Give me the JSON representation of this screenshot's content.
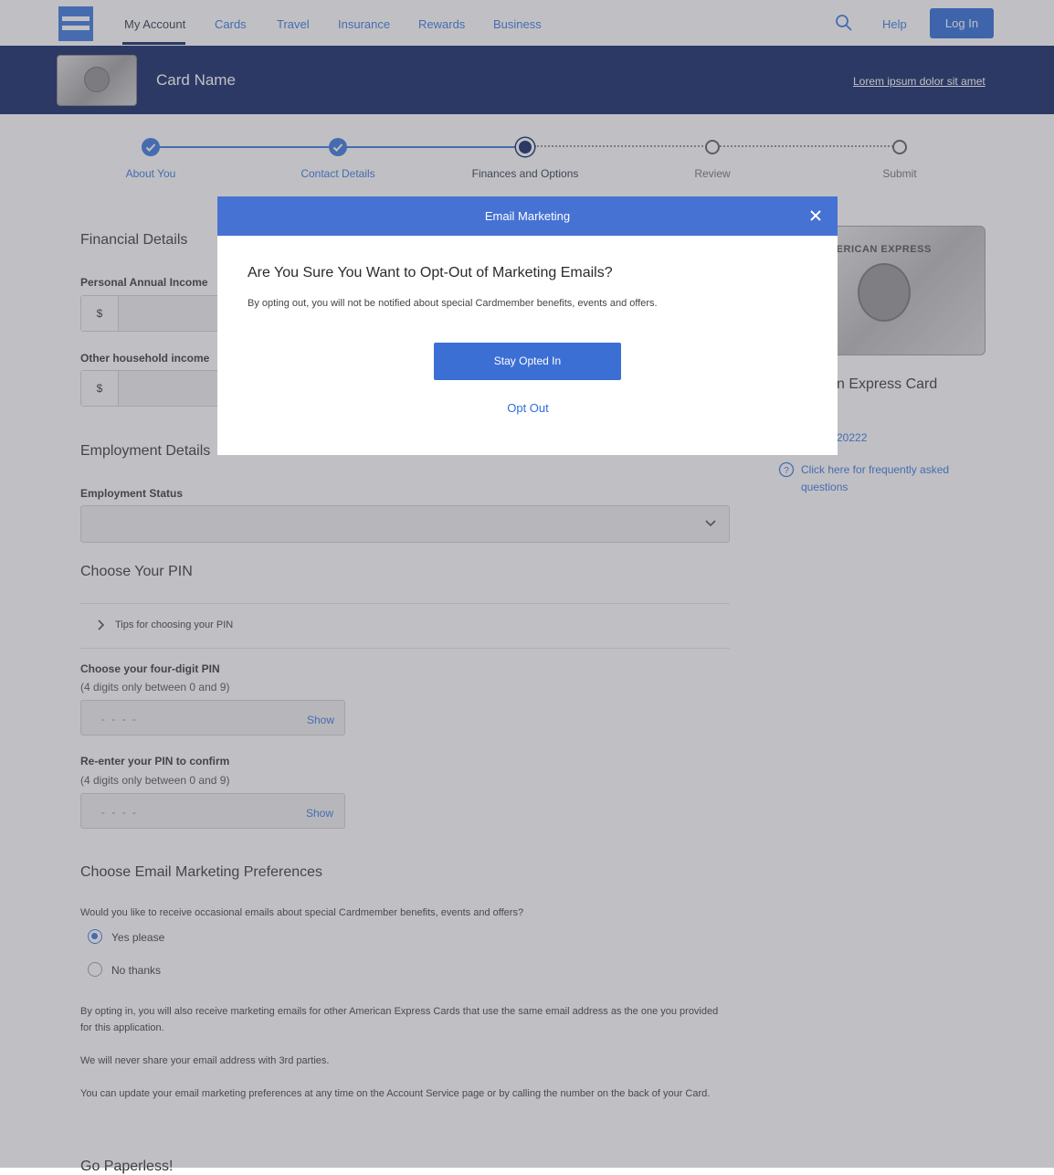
{
  "nav": {
    "items": [
      "My Account",
      "Cards",
      "Travel",
      "Insurance",
      "Rewards",
      "Business"
    ],
    "help": "Help",
    "login": "Log In"
  },
  "banner": {
    "card_name": "Card Name",
    "link": "Lorem ipsum dolor sit amet"
  },
  "progress": {
    "steps": [
      "About You",
      "Contact Details",
      "Finances and Options",
      "Review",
      "Submit"
    ],
    "current_step": 3
  },
  "financial": {
    "title": "Financial Details",
    "income_label": "Personal Annual Income",
    "household_label": "Other household income",
    "currency": "$"
  },
  "employment": {
    "title": "Employment Details",
    "status_label": "Employment Status"
  },
  "pin": {
    "title": "Choose Your PIN",
    "tips": "Tips for choosing your PIN",
    "choose_label": "Choose your four-digit PIN",
    "choose_hint": "(4 digits only between 0 and 9)",
    "confirm_label": "Re-enter your PIN to confirm",
    "confirm_hint": "(4 digits only between 0 and 9)",
    "placeholder": "- - - -",
    "show": "Show"
  },
  "email_prefs": {
    "title": "Choose Email Marketing Preferences",
    "question": "Would you like to receive occasional emails about special Cardmember benefits, events and offers?",
    "yes": "Yes please",
    "no": "No thanks",
    "selected": "yes",
    "note1": "By opting in, you will also receive marketing emails for other American Express Cards that use the same email address as the one you provided for this application.",
    "note2": "We will never share your email address with 3rd parties.",
    "note3": "You can update your email marketing preferences at any time on the Account Service page or by calling the number on the back of your Card."
  },
  "footer_partial": "Go Paperless!",
  "sidebar": {
    "card_brand": "MERICAN EXPRESS",
    "card_title": "n Express Card",
    "code": "20222",
    "faq": "Click here for frequently asked questions"
  },
  "modal": {
    "title": "Email Marketing",
    "question": "Are You Sure You Want to Opt-Out of Marketing Emails?",
    "description": "By opting out, you will not be notified about special Cardmember benefits, events and offers.",
    "stay_button": "Stay Opted In",
    "opt_out": "Opt Out"
  },
  "colors": {
    "brand_blue": "#2d6fdb",
    "navy": "#00175a",
    "modal_header": "#4672d4"
  }
}
